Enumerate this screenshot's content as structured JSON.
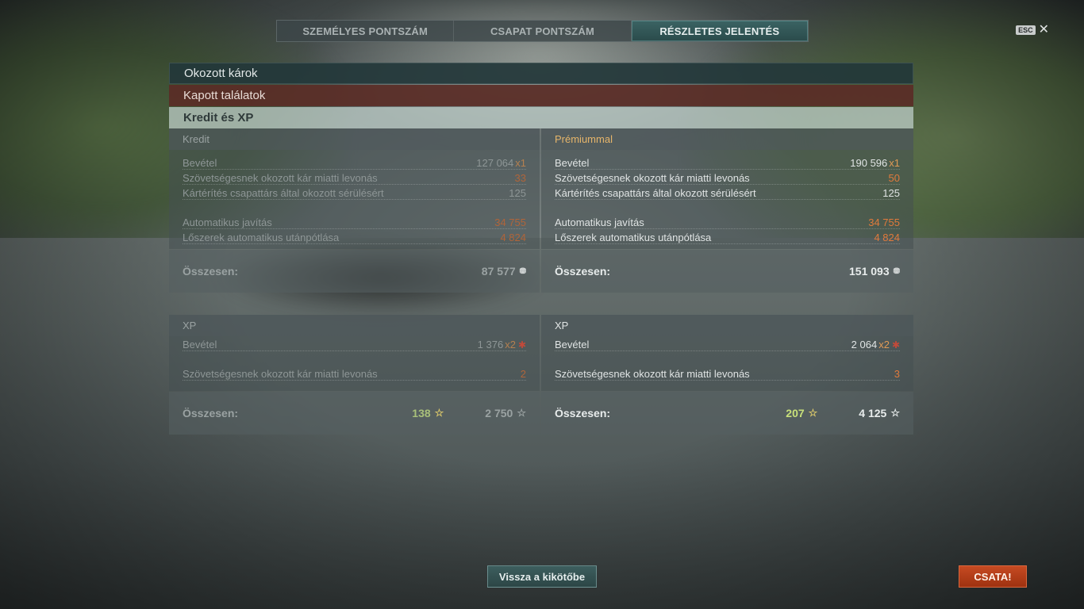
{
  "tabs": [
    {
      "label": "SZEMÉLYES PONTSZÁM",
      "active": false
    },
    {
      "label": "CSAPAT PONTSZÁM",
      "active": false
    },
    {
      "label": "RÉSZLETES JELENTÉS",
      "active": true
    }
  ],
  "esc": {
    "key": "ESC",
    "close": "✕"
  },
  "sections": {
    "damage_dealt": "Okozott károk",
    "hits_received": "Kapott találatok",
    "credits_xp": "Kredit és XP"
  },
  "credit": {
    "left": {
      "header": "Kredit",
      "income_label": "Bevétel",
      "income_value": "127 064",
      "income_mult": "x1",
      "ally_damage_label": "Szövetségesnek okozott kár miatti levonás",
      "ally_damage_value": "33",
      "compensation_label": "Kártérítés csapattárs által okozott sérülésért",
      "compensation_value": "125",
      "repair_label": "Automatikus javítás",
      "repair_value": "34 755",
      "ammo_label": "Lőszerek automatikus utánpótlása",
      "ammo_value": "4 824",
      "total_label": "Összesen:",
      "total_value": "87 577"
    },
    "right": {
      "header": "Prémiummal",
      "income_label": "Bevétel",
      "income_value": "190 596",
      "income_mult": "x1",
      "ally_damage_label": "Szövetségesnek okozott kár miatti levonás",
      "ally_damage_value": "50",
      "compensation_label": "Kártérítés csapattárs által okozott sérülésért",
      "compensation_value": "125",
      "repair_label": "Automatikus javítás",
      "repair_value": "34 755",
      "ammo_label": "Lőszerek automatikus utánpótlása",
      "ammo_value": "4 824",
      "total_label": "Összesen:",
      "total_value": "151 093"
    }
  },
  "xp": {
    "left": {
      "header": "XP",
      "income_label": "Bevétel",
      "income_value": "1 376",
      "income_mult": "x2",
      "ally_damage_label": "Szövetségesnek okozott kár miatti levonás",
      "ally_damage_value": "2",
      "total_label": "Összesen:",
      "total_green": "138",
      "total_value": "2 750"
    },
    "right": {
      "header": "XP",
      "income_label": "Bevétel",
      "income_value": "2 064",
      "income_mult": "x2",
      "ally_damage_label": "Szövetségesnek okozott kár miatti levonás",
      "ally_damage_value": "3",
      "total_label": "Összesen:",
      "total_green": "207",
      "total_value": "4 125"
    }
  },
  "icons": {
    "coin": "coin-icon",
    "star": "star-icon",
    "xp_flag": "signal-flag-icon"
  },
  "buttons": {
    "back": "Vissza a kikötőbe",
    "battle": "CSATA!"
  }
}
